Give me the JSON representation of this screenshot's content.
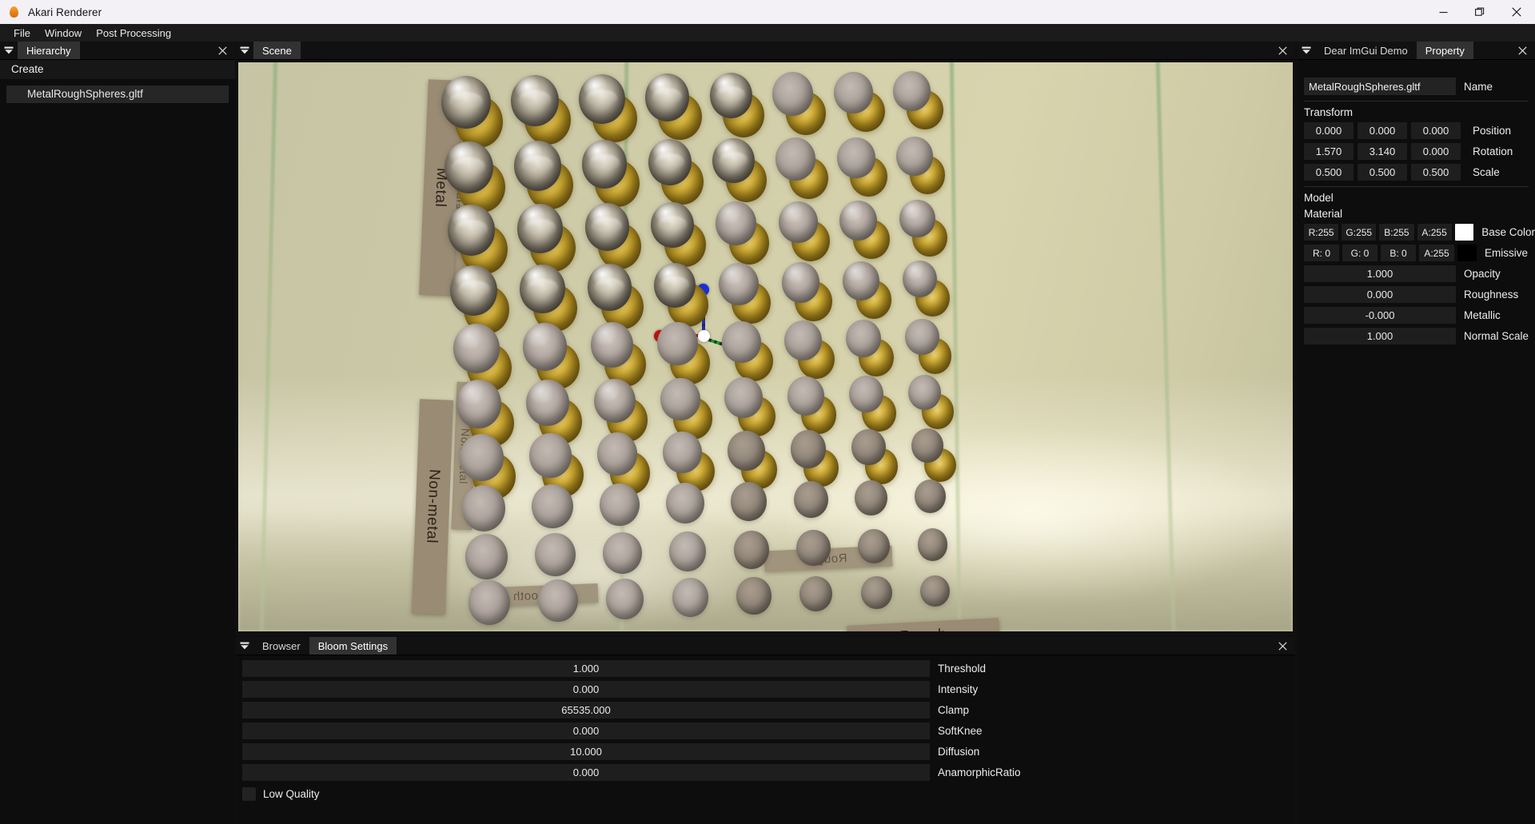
{
  "window": {
    "title": "Akari Renderer",
    "icon": "flame-icon",
    "controls": {
      "minimize": "minimize-icon",
      "maximize": "maximize-icon",
      "close": "close-icon"
    }
  },
  "menubar": {
    "items": [
      "File",
      "Window",
      "Post Processing"
    ]
  },
  "hierarchy": {
    "tab": "Hierarchy",
    "close": "×",
    "create_label": "Create",
    "items": [
      "MetalRoughSpheres.gltf"
    ]
  },
  "scene": {
    "tab": "Scene",
    "close": "×",
    "plaques": [
      {
        "text": "Metal"
      },
      {
        "text": "Metal"
      },
      {
        "text": "Non-metal"
      },
      {
        "text": "Non-metal"
      },
      {
        "text": "Smooth"
      },
      {
        "text": "Rough"
      },
      {
        "text": "Rough"
      }
    ],
    "gizmo": {
      "axes": [
        {
          "name": "x-axis",
          "color": "#cc1111"
        },
        {
          "name": "y-axis",
          "color": "#11aa22"
        },
        {
          "name": "z-axis",
          "color": "#1122dd"
        }
      ],
      "center_color": "#ffffff"
    }
  },
  "bottom_panel": {
    "tabs": [
      {
        "label": "Browser",
        "active": false
      },
      {
        "label": "Bloom Settings",
        "active": true
      }
    ],
    "close": "×",
    "bloom": {
      "fields": [
        {
          "label": "Threshold",
          "value": "1.000"
        },
        {
          "label": "Intensity",
          "value": "0.000"
        },
        {
          "label": "Clamp",
          "value": "65535.000"
        },
        {
          "label": "SoftKnee",
          "value": "0.000"
        },
        {
          "label": "Diffusion",
          "value": "10.000"
        },
        {
          "label": "AnamorphicRatio",
          "value": "0.000"
        }
      ],
      "checkbox": {
        "label": "Low Quality",
        "checked": false
      }
    }
  },
  "property": {
    "tabs": [
      {
        "label": "Dear ImGui Demo",
        "active": false
      },
      {
        "label": "Property",
        "active": true
      }
    ],
    "close": "×",
    "name": {
      "value": "MetalRoughSpheres.gltf",
      "label": "Name"
    },
    "transform": {
      "title": "Transform",
      "rows": [
        {
          "label": "Position",
          "values": [
            "0.000",
            "0.000",
            "0.000"
          ]
        },
        {
          "label": "Rotation",
          "values": [
            "1.570",
            "3.140",
            "0.000"
          ]
        },
        {
          "label": "Scale",
          "values": [
            "0.500",
            "0.500",
            "0.500"
          ]
        }
      ]
    },
    "model": {
      "title": "Model"
    },
    "material": {
      "title": "Material",
      "base_color": {
        "label": "Base Color",
        "channels": [
          "R:255",
          "G:255",
          "B:255",
          "A:255"
        ],
        "swatch": "#ffffff"
      },
      "emissive": {
        "label": "Emissive",
        "channels": [
          "R:  0",
          "G:  0",
          "B:  0",
          "A:255"
        ],
        "swatch": "#000000"
      },
      "scalars": [
        {
          "label": "Opacity",
          "value": "1.000"
        },
        {
          "label": "Roughness",
          "value": "0.000"
        },
        {
          "label": "Metallic",
          "value": "-0.000"
        },
        {
          "label": "Normal Scale",
          "value": "1.000"
        }
      ]
    }
  },
  "theme": {
    "titlebar_bg": "#f3f0f6",
    "panel_bg": "#0d0d0d",
    "tab_active_bg": "#323232",
    "field_bg": "#1e1e1e",
    "text": "#ececec"
  }
}
